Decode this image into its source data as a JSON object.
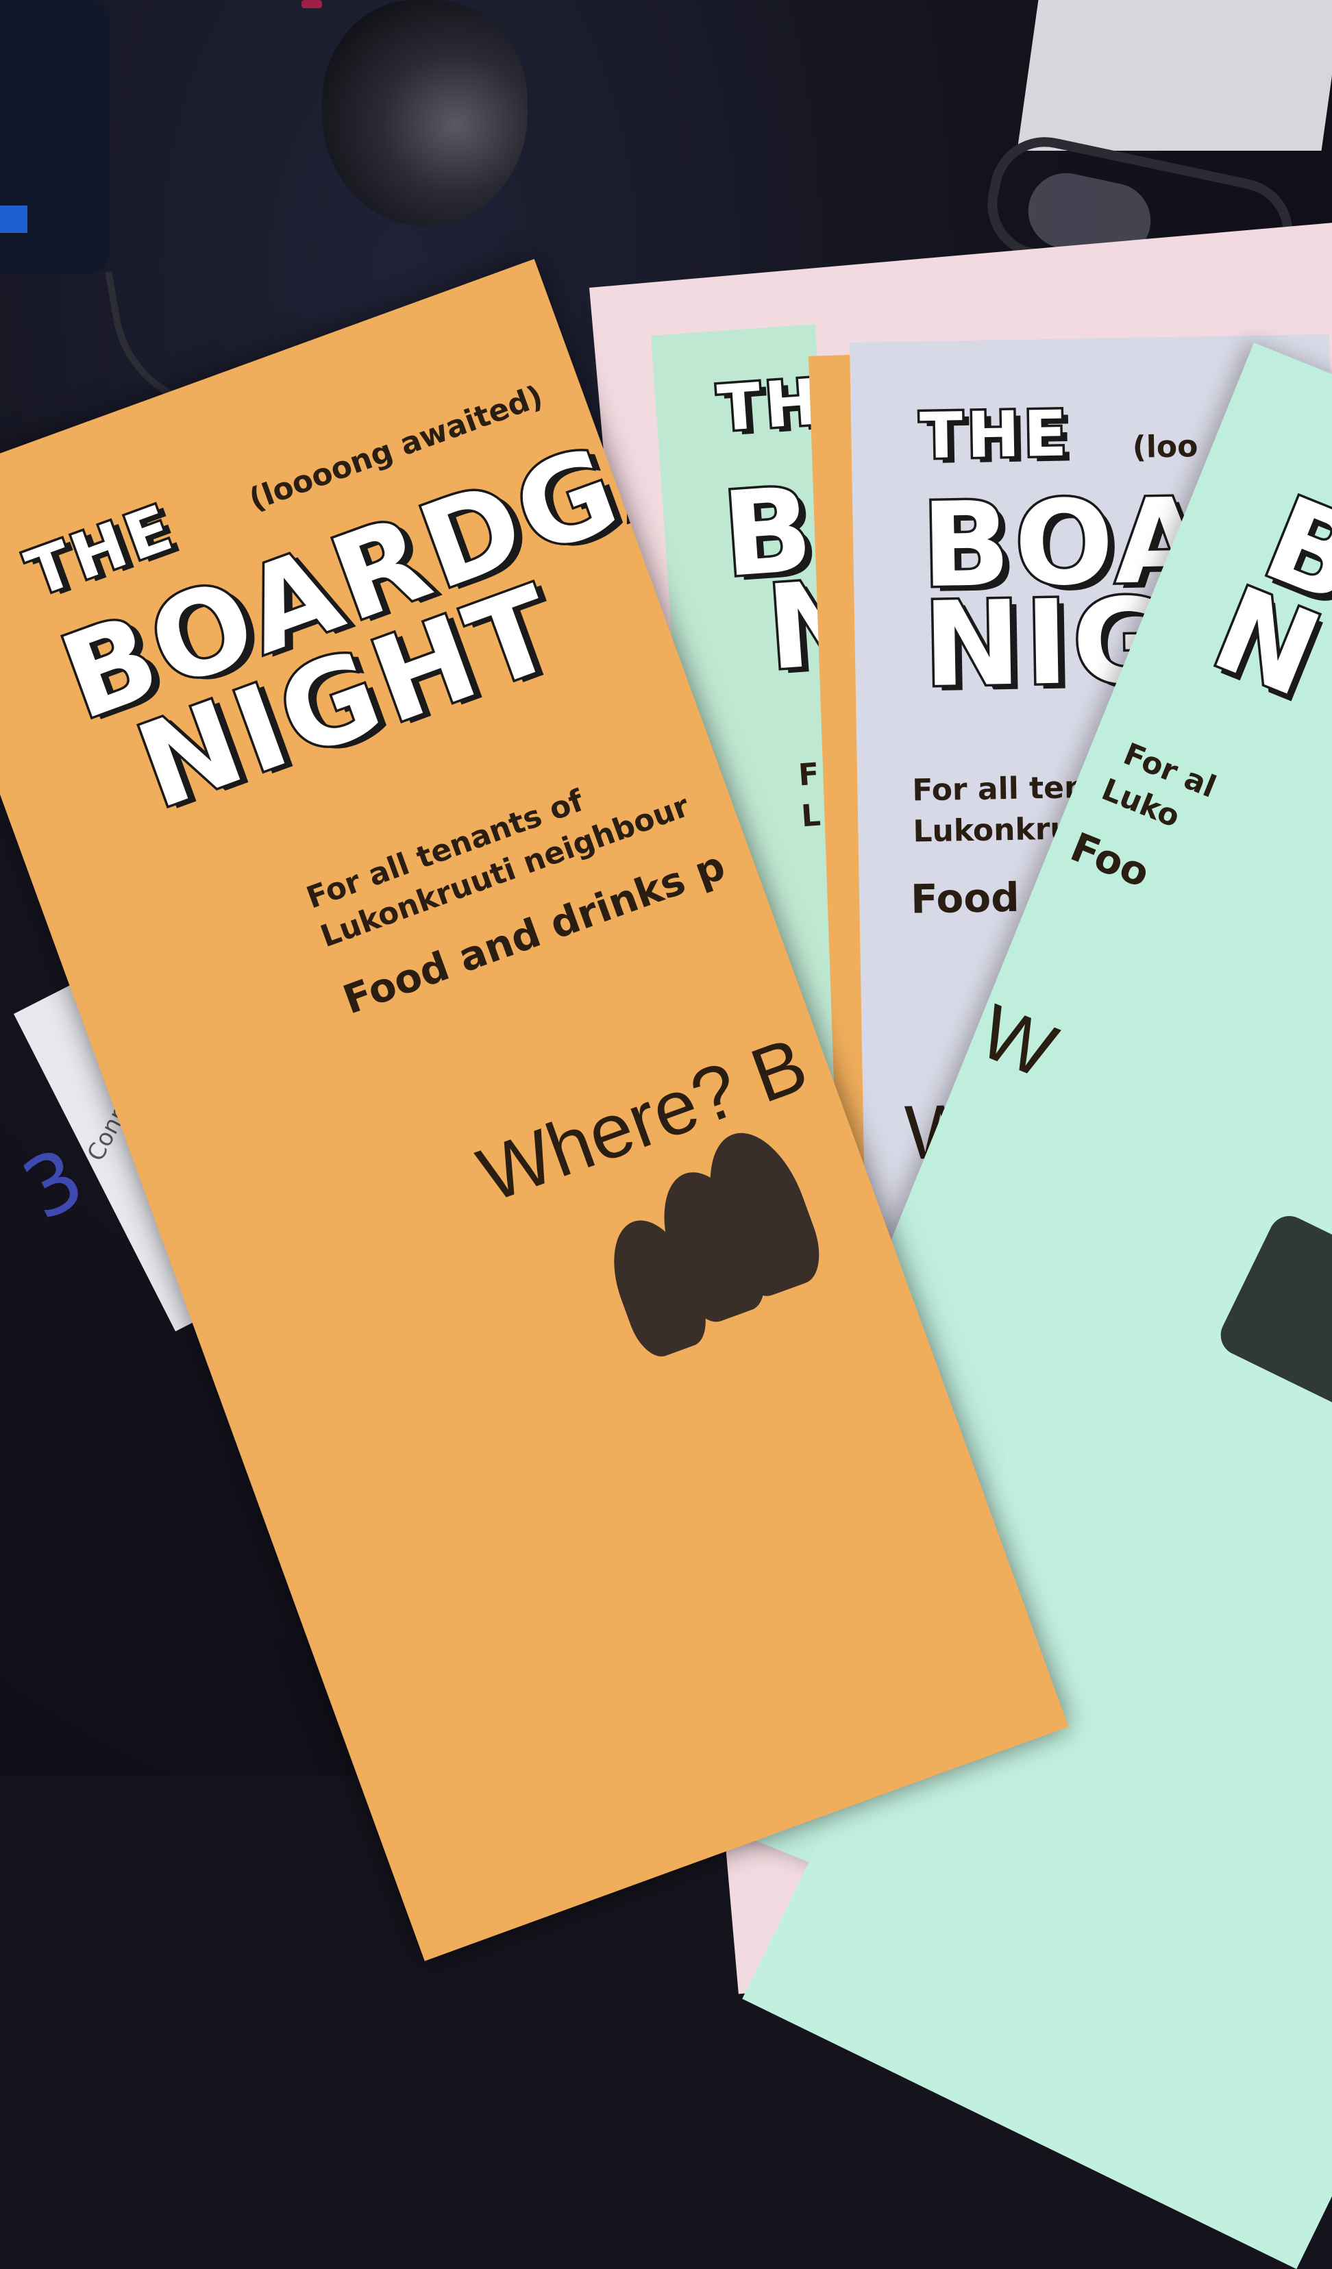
{
  "flyer": {
    "the": "THE",
    "subtitle_paren": "(loooong awaited)",
    "title_board": "BOARDGA",
    "title_night": "NIGHT",
    "tenants_line1": "For all tenants of",
    "tenants_line2": "Lukonkruuti neighbour",
    "food_line": "Food and drinks p",
    "where_line": "Where? B"
  },
  "flyer_grey": {
    "the": "THE",
    "subtitle_paren": "(loo",
    "title_board": "BOA",
    "title_night": "NIG",
    "tenants_line1": "For all tena",
    "tenants_line2": "Lukonkruu",
    "food_line": "Food an",
    "where_line": "Whe"
  },
  "flyer_green_right": {
    "the": "T",
    "title_board": "B",
    "title_night": "N",
    "tenants_line1": "For al",
    "tenants_line2": "Luko",
    "food_line": "Foo",
    "where_line": "W"
  },
  "flyer_green_left": {
    "the": "TH",
    "title_board": "B",
    "title_night": "N",
    "tenants_line1": "F",
    "tenants_line2": "L"
  },
  "card": {
    "number": "3",
    "label": "Connect"
  },
  "colors": {
    "orange_flyer": "#f0ae5c",
    "green_flyer": "#bfe8d2",
    "grey_flyer": "#d8d9e6",
    "pink_flyer": "#f2dbe0"
  }
}
